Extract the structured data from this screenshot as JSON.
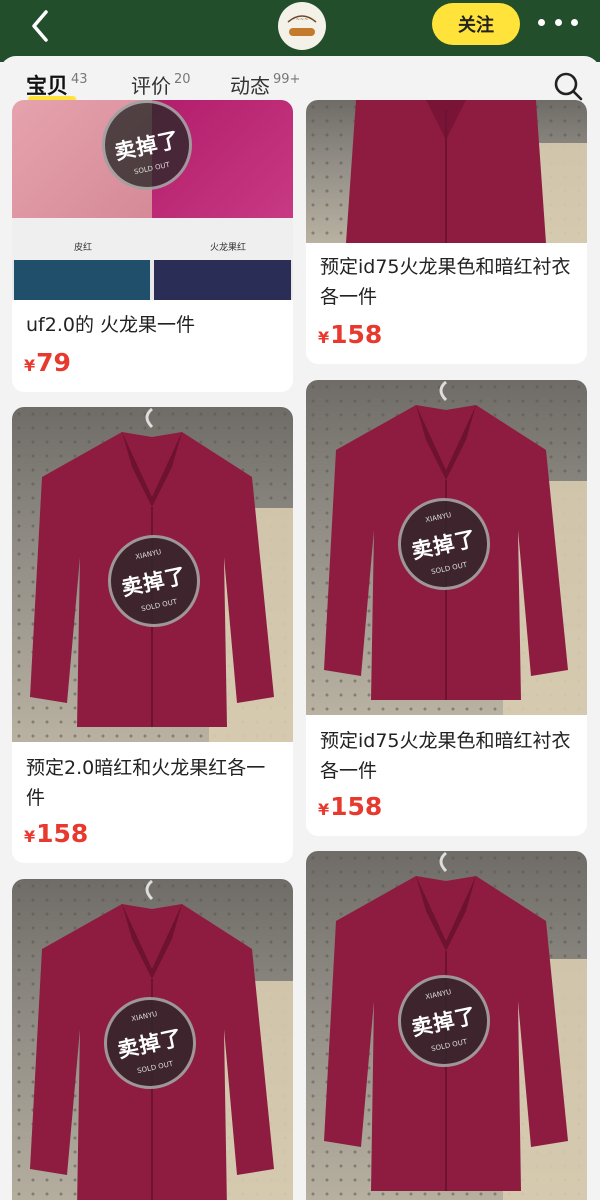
{
  "header": {
    "follow_label": "关注",
    "icons": {
      "back": "chevron-left-icon",
      "more": "ellipsis-icon",
      "search": "search-icon"
    },
    "colors": {
      "bar": "#234e2b",
      "accent": "#ffe23a"
    }
  },
  "tabs": [
    {
      "label": "宝贝",
      "count": "43",
      "active": true
    },
    {
      "label": "评价",
      "count": "20",
      "active": false
    },
    {
      "label": "动态",
      "count": "99+",
      "active": false
    }
  ],
  "stamp": {
    "text": "卖掉了",
    "sub": "SOLD OUT",
    "top": "XIANYU"
  },
  "items": [
    {
      "title": "uf2.0的 火龙果一件",
      "currency": "¥",
      "price": "79",
      "image": "fabric swatches",
      "swatch_labels": [
        "皮红",
        "火龙果红"
      ]
    },
    {
      "title": "预定id75火龙果色和暗红衬衣各一件",
      "currency": "¥",
      "price": "158",
      "image": "red shirt"
    },
    {
      "title": "预定2.0暗红和火龙果红各一件",
      "currency": "¥",
      "price": "158",
      "image": "red shirt"
    },
    {
      "title": "预定id75火龙果色和暗红衬衣各一件",
      "currency": "¥",
      "price": "158",
      "image": "red shirt"
    },
    {
      "title": "",
      "currency": "",
      "price": "",
      "image": "red shirt"
    },
    {
      "title": "",
      "currency": "",
      "price": "",
      "image": "red shirt"
    }
  ]
}
